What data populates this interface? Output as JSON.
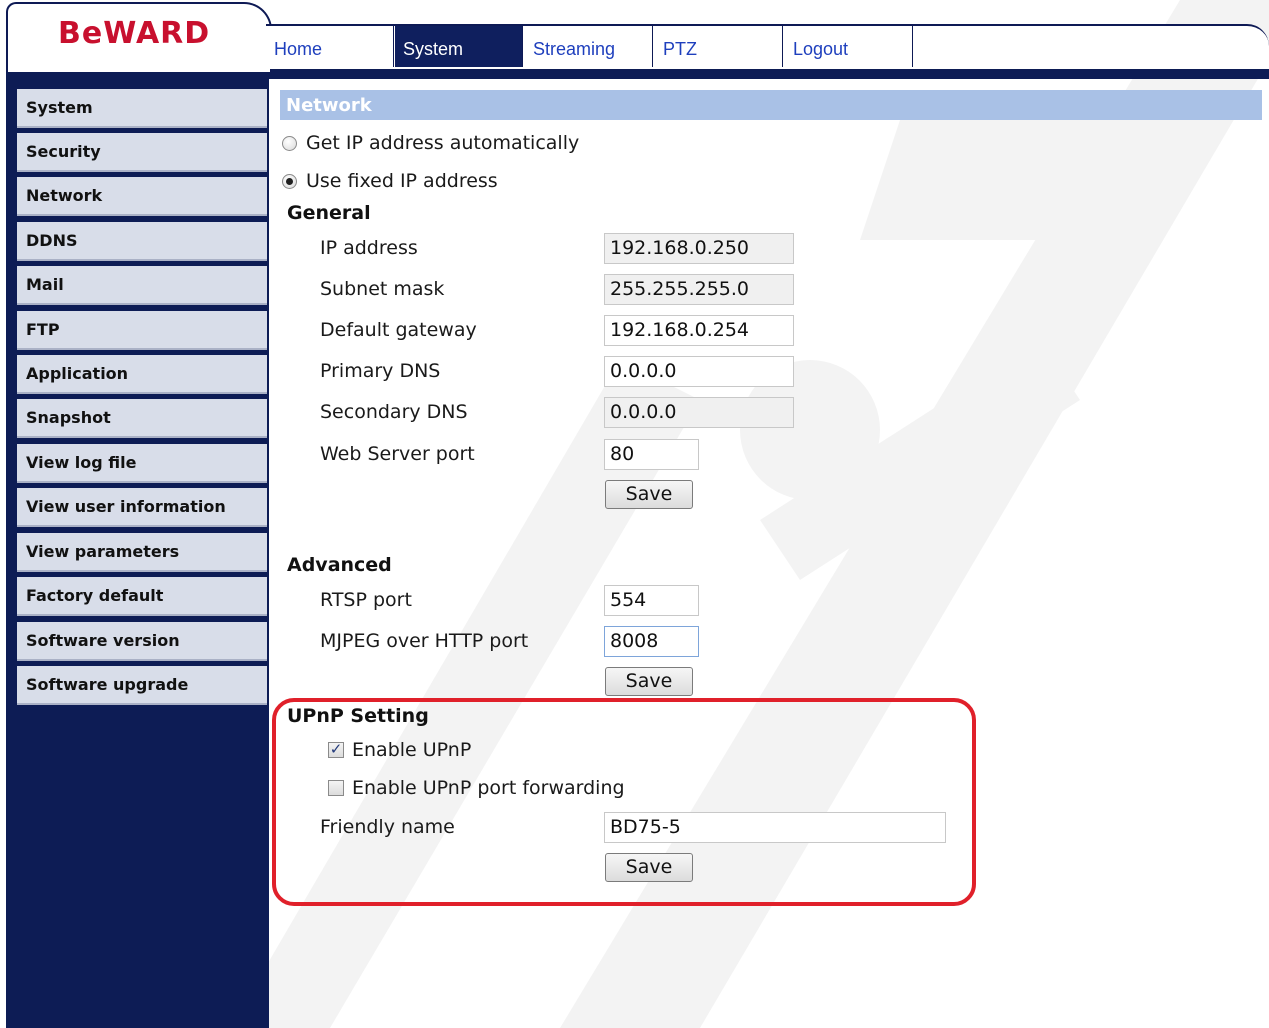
{
  "brand": {
    "logo": "BeWARD",
    "logo_color": "#c8102e"
  },
  "nav": {
    "tabs": [
      "Home",
      "System",
      "Streaming",
      "PTZ",
      "Logout"
    ],
    "active": "System"
  },
  "sidebar": {
    "items": [
      "System",
      "Security",
      "Network",
      "DDNS",
      "Mail",
      "FTP",
      "Application",
      "Snapshot",
      "View log file",
      "View user information",
      "View parameters",
      "Factory default",
      "Software version",
      "Software upgrade"
    ]
  },
  "page": {
    "title": "Network",
    "ip_mode": {
      "auto_label": "Get IP address automatically",
      "fixed_label": "Use fixed IP address",
      "selected": "fixed"
    },
    "general": {
      "heading": "General",
      "ip_label": "IP address",
      "ip_value": "192.168.0.250",
      "mask_label": "Subnet mask",
      "mask_value": "255.255.255.0",
      "gateway_label": "Default gateway",
      "gateway_value": "192.168.0.254",
      "dns1_label": "Primary DNS",
      "dns1_value": "0.0.0.0",
      "dns2_label": "Secondary DNS",
      "dns2_value": "0.0.0.0",
      "web_port_label": "Web Server port",
      "web_port_value": "80",
      "save_label": "Save"
    },
    "advanced": {
      "heading": "Advanced",
      "rtsp_label": "RTSP port",
      "rtsp_value": "554",
      "mjpeg_label": "MJPEG over HTTP port",
      "mjpeg_value": "8008",
      "save_label": "Save"
    },
    "upnp": {
      "heading": "UPnP Setting",
      "enable_label": "Enable UPnP",
      "enable_checked": true,
      "forward_label": "Enable UPnP port forwarding",
      "forward_checked": false,
      "friendly_label": "Friendly name",
      "friendly_value": "BD75-5",
      "save_label": "Save"
    }
  },
  "colors": {
    "navy": "#0d1c55",
    "section_bar": "#a9c1e6",
    "highlight": "#e0202a"
  }
}
